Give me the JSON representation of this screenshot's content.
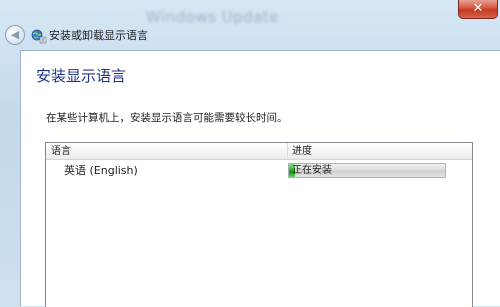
{
  "window": {
    "title_blurred": "Windows Update",
    "close_glyph": "✕"
  },
  "nav": {
    "back_glyph": "◀",
    "app_icon": "language-globe-icon",
    "title": "安装或卸载显示语言"
  },
  "content": {
    "heading": "安装显示语言",
    "description": "在某些计算机上，安装显示语言可能需要较长时间。",
    "list": {
      "columns": [
        "语言",
        "进度"
      ],
      "rows": [
        {
          "language": "英语 (English)",
          "progress_text": "正在安装",
          "progress_percent": 4
        }
      ]
    }
  },
  "colors": {
    "heading": "#1e3287",
    "progress_green": "#2fb42a",
    "close_red": "#c23a22"
  }
}
